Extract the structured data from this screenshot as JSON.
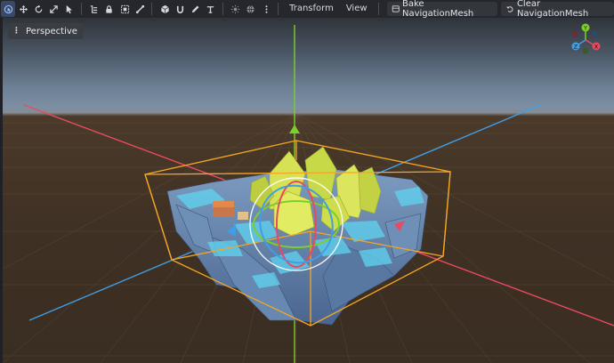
{
  "toolbar": {
    "tools": [
      {
        "name": "select-mode-icon",
        "active": true
      },
      {
        "name": "move-mode-icon"
      },
      {
        "name": "rotate-mode-icon"
      },
      {
        "name": "scale-mode-icon"
      },
      {
        "name": "pointer-icon"
      },
      {
        "name": "list-select-icon"
      },
      {
        "name": "lock-icon"
      },
      {
        "name": "group-icon"
      },
      {
        "name": "bone-icon"
      },
      {
        "name": "cube-icon"
      },
      {
        "name": "snap-icon"
      },
      {
        "name": "pencil-icon"
      },
      {
        "name": "ruler-icon"
      },
      {
        "name": "sun-icon"
      },
      {
        "name": "environment-icon"
      },
      {
        "name": "more-icon"
      }
    ],
    "menus": [
      "Transform",
      "View"
    ],
    "bake_label": "Bake NavigationMesh",
    "clear_label": "Clear NavigationMesh"
  },
  "viewport": {
    "perspective_label": "Perspective",
    "gizmo": {
      "y": "Y",
      "z": "Z",
      "x": "X"
    }
  },
  "colors": {
    "axis_x": "#e84a60",
    "axis_y": "#7ccf2a",
    "axis_z": "#3f9ee6",
    "bounding_box": "#f5a623",
    "navmesh": "#5fd4f0"
  }
}
